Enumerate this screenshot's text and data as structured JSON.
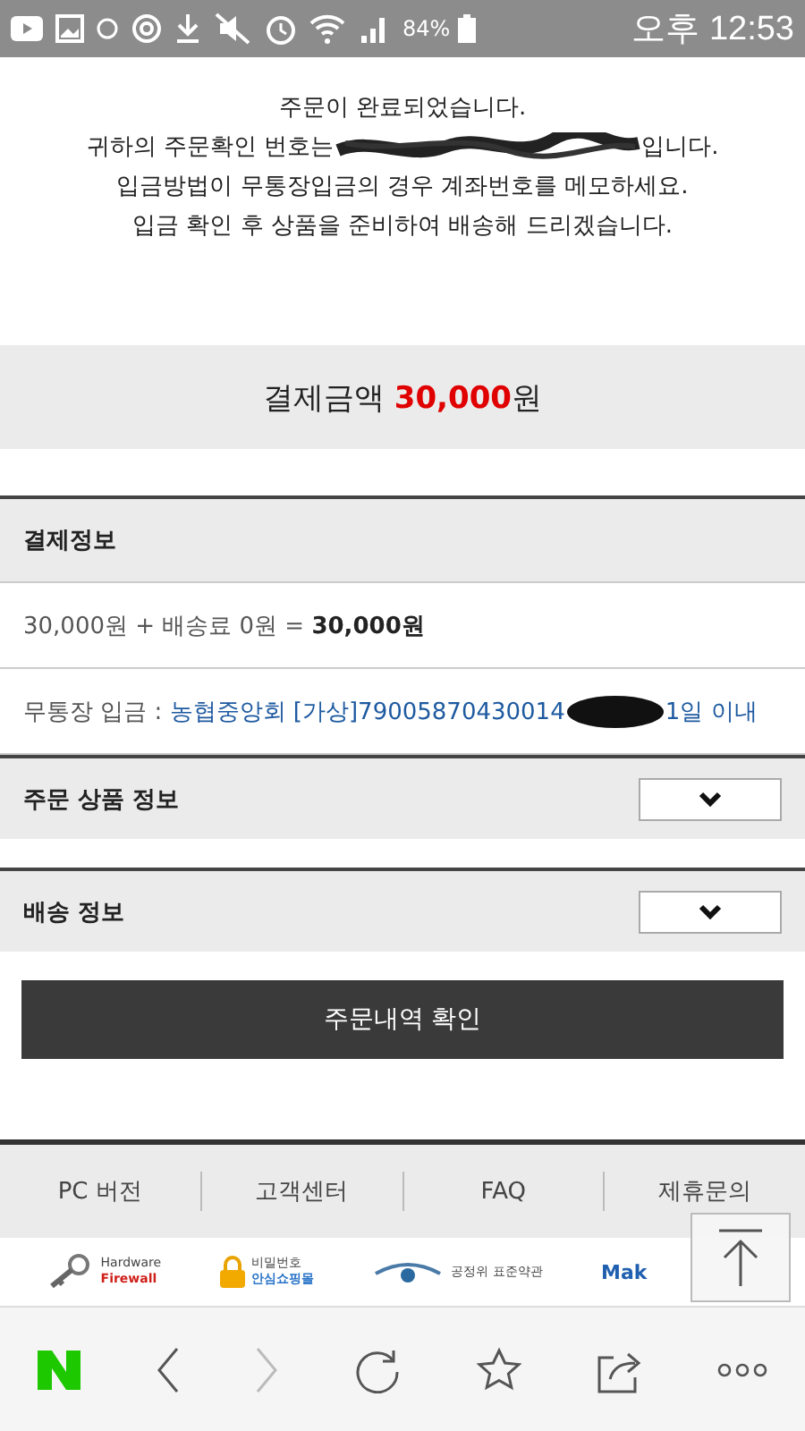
{
  "status_bar": {
    "battery": "84%",
    "time": "오후 12:53"
  },
  "message": {
    "line1": "주문이 완료되었습니다.",
    "line2_before": "귀하의 주문확인 번호는",
    "line2_after": "입니다.",
    "line3": "입금방법이 무통장입금의 경우 계좌번호를 메모하세요.",
    "line4": "입금 확인 후 상품을 준비하여 배송해 드리겠습니다."
  },
  "total": {
    "label": "결제금액",
    "amount": "30,000",
    "unit": "원"
  },
  "sections": [
    {
      "kind": "open",
      "title": "결제정보",
      "rows": [
        {
          "kind": "sum",
          "text": "30,000원 + 배송료 0원 = **30,000원**"
        },
        {
          "kind": "account",
          "label": "무통장 입금 : ",
          "link": "농협중앙회 [가상]79005870430014",
          "after": "1일 이내"
        }
      ]
    },
    {
      "kind": "collapsed",
      "title": "주문 상품 정보"
    },
    {
      "kind": "collapsed",
      "title": "배송 정보"
    }
  ],
  "confirm_button": "주문내역 확인",
  "footer_links": [
    "PC 버전",
    "고객센터",
    "FAQ",
    "제휴문의"
  ],
  "badges": [
    {
      "kind": "keys",
      "line1": "Hardware",
      "line2": "Firewall"
    },
    {
      "kind": "lock",
      "line1": "비밀번호",
      "line2": "안심쇼핑몰"
    },
    {
      "kind": "eye",
      "line1": "공정위 표준약관"
    },
    {
      "kind": "brand",
      "line1": "Mak"
    }
  ]
}
